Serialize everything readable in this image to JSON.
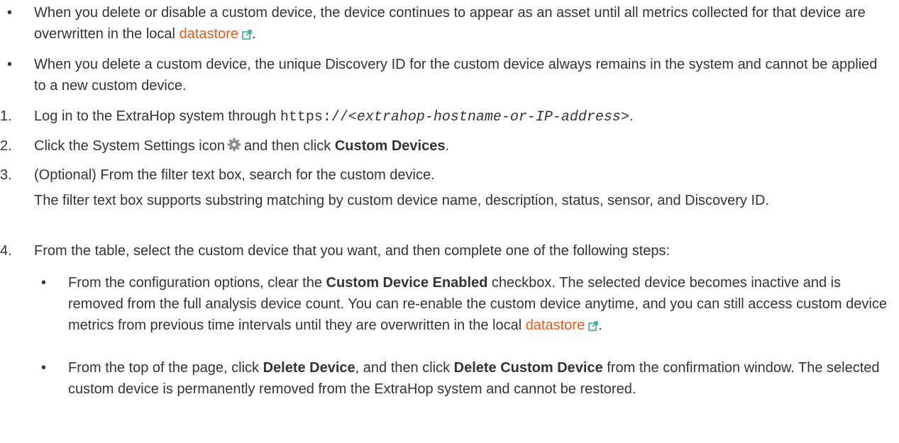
{
  "bullets": [
    {
      "text_before": "When you delete or disable a custom device, the device continues to appear as an asset until all metrics collected for that device are overwritten in the local ",
      "link": "datastore",
      "text_after": "."
    },
    {
      "text": "When you delete a custom device, the unique Discovery ID for the custom device always remains in the system and cannot be applied to a new custom device."
    }
  ],
  "steps": [
    {
      "num": "1.",
      "text_before": "Log in to the ExtraHop system through ",
      "code_prefix": "https://",
      "code_italic": "<extrahop-hostname-or-IP-address>",
      "text_after": "."
    },
    {
      "num": "2.",
      "text_before": "Click the System Settings icon",
      "icon": "gear-icon",
      "text_middle": "and then click ",
      "bold": "Custom Devices",
      "text_after": "."
    },
    {
      "num": "3.",
      "text": "(Optional) From the filter text box, search for the custom device.",
      "note": "The filter text box supports substring matching by custom device name, description, status, sensor, and Discovery ID."
    },
    {
      "num": "4.",
      "text": "From the table, select the custom device that you want, and then complete one of the following steps:",
      "subitems": [
        {
          "text_before": "From the configuration options, clear the ",
          "bold": "Custom Device Enabled",
          "text_after": " checkbox. The selected device becomes inactive and is removed from the full analysis device count. You can re-enable the custom device anytime, and you can still access custom device metrics from previous time intervals until they are overwritten in the local ",
          "link": "datastore",
          "text_end": "."
        },
        {
          "text_before": "From the top of the page, click ",
          "bold1": "Delete Device",
          "text_middle": ", and then click ",
          "bold2": "Delete Custom Device",
          "text_after": " from the confirmation window. The selected custom device is permanently removed from the ExtraHop system and cannot be restored."
        }
      ]
    }
  ],
  "colors": {
    "text": "#333333",
    "link": "#e85a1c",
    "external_icon": "#2aa198",
    "gear_icon": "#8a8a8a"
  }
}
